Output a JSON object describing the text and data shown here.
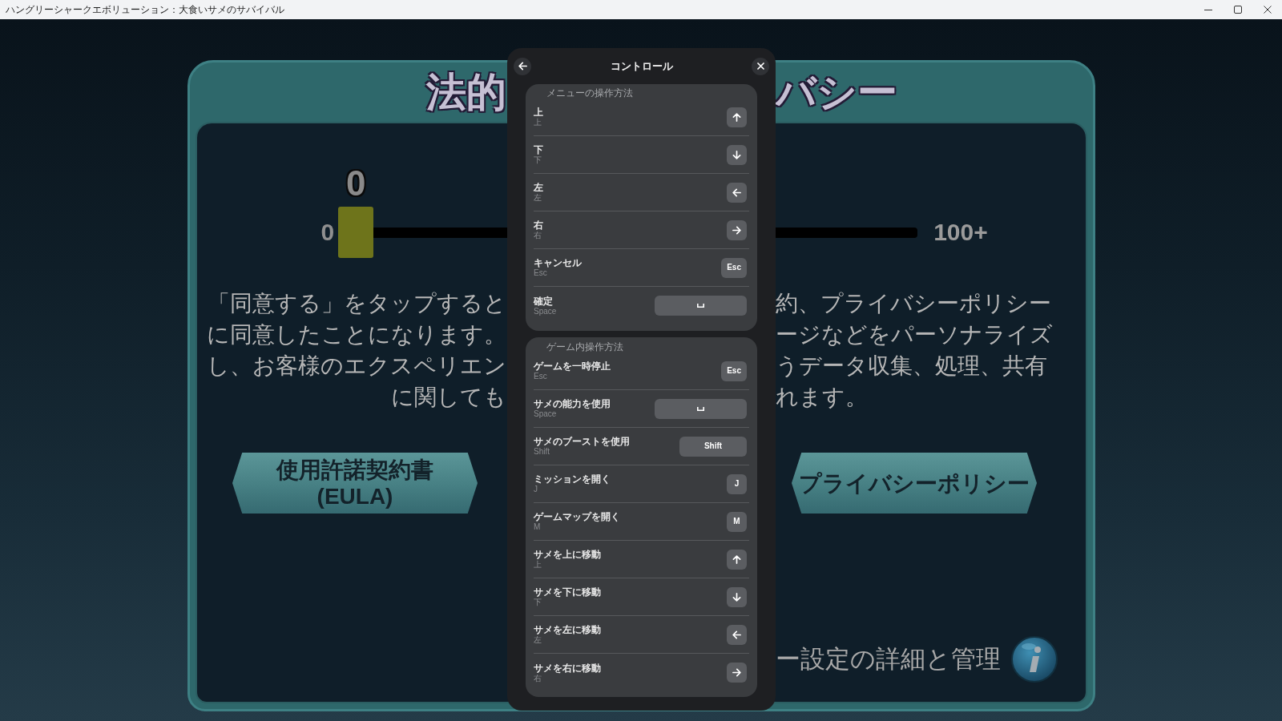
{
  "window": {
    "title": "ハングリーシャークエボリューション：大食いサメのサバイバル"
  },
  "page": {
    "title_left": "法的",
    "title_right": "バシー",
    "slider": {
      "value_label": "0",
      "min_label": "0",
      "max_label": "100+",
      "level": 0
    },
    "paragraph_lines": [
      {
        "left": "「同意する」をタップすると",
        "right": "約、プライバシーポリシー"
      },
      {
        "left": "に同意したことになります。",
        "right": "ージなどをパーソナライズ"
      },
      {
        "left": "し、お客様のエクスペリエン",
        "right": "うデータ収集、処理、共有"
      },
      {
        "left": "に関しても",
        "right": "れます。"
      }
    ],
    "buttons": [
      {
        "lines": [
          "使用許諾契約書",
          "(EULA)"
        ]
      },
      {
        "lines": [
          "プライバシーポリシー"
        ]
      }
    ],
    "settings_link": "ー設定の詳細と管理"
  },
  "dialog": {
    "title": "コントロール",
    "sections": [
      {
        "title": "メニューの操作方法",
        "rows": [
          {
            "label": "上",
            "binding": "上",
            "key": {
              "kind": "arrow_up"
            }
          },
          {
            "label": "下",
            "binding": "下",
            "key": {
              "kind": "arrow_down"
            }
          },
          {
            "label": "左",
            "binding": "左",
            "key": {
              "kind": "arrow_left"
            }
          },
          {
            "label": "右",
            "binding": "右",
            "key": {
              "kind": "arrow_right"
            }
          },
          {
            "label": "キャンセル",
            "binding": "Esc",
            "key": {
              "kind": "text",
              "label": "Esc"
            }
          },
          {
            "label": "確定",
            "binding": "Space",
            "key": {
              "kind": "space"
            }
          }
        ]
      },
      {
        "title": "ゲーム内操作方法",
        "rows": [
          {
            "label": "ゲームを一時停止",
            "binding": "Esc",
            "key": {
              "kind": "text",
              "label": "Esc"
            }
          },
          {
            "label": "サメの能力を使用",
            "binding": "Space",
            "key": {
              "kind": "space"
            }
          },
          {
            "label": "サメのブーストを使用",
            "binding": "Shift",
            "key": {
              "kind": "wide_text",
              "label": "Shift"
            }
          },
          {
            "label": "ミッションを開く",
            "binding": "J",
            "key": {
              "kind": "text",
              "label": "J"
            }
          },
          {
            "label": "ゲームマップを開く",
            "binding": "M",
            "key": {
              "kind": "text",
              "label": "M"
            }
          },
          {
            "label": "サメを上に移動",
            "binding": "上",
            "key": {
              "kind": "arrow_up"
            }
          },
          {
            "label": "サメを下に移動",
            "binding": "下",
            "key": {
              "kind": "arrow_down"
            }
          },
          {
            "label": "サメを左に移動",
            "binding": "左",
            "key": {
              "kind": "arrow_left"
            }
          },
          {
            "label": "サメを右に移動",
            "binding": "右",
            "key": {
              "kind": "arrow_right"
            }
          }
        ]
      }
    ]
  }
}
